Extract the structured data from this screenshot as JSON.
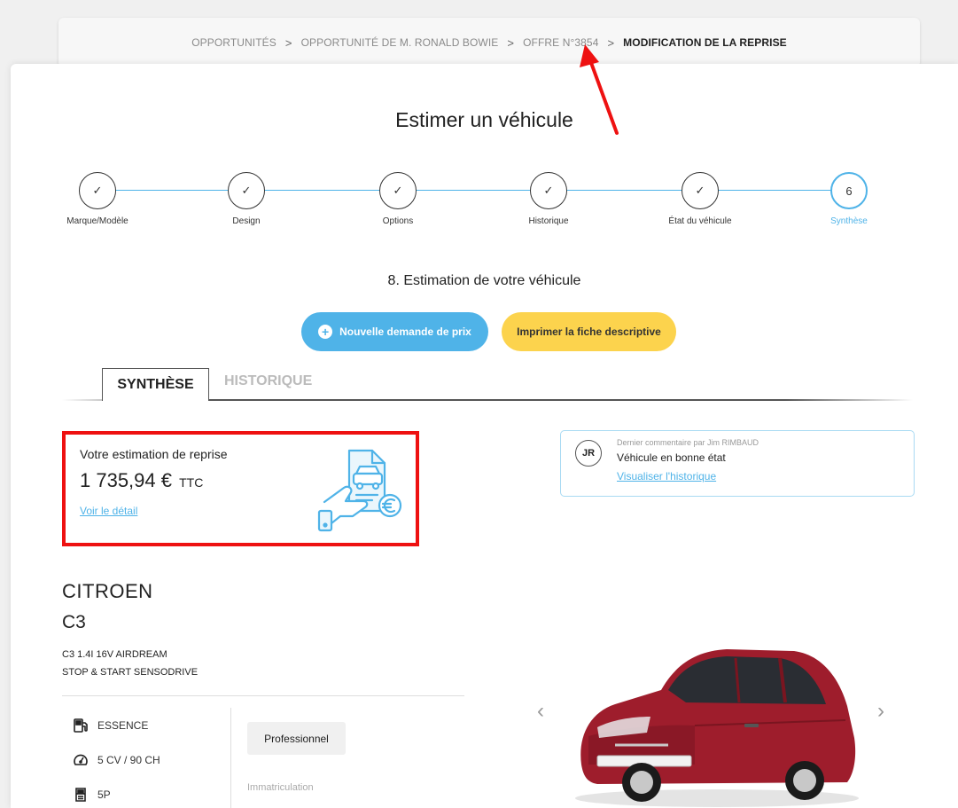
{
  "breadcrumb": {
    "items": [
      "OPPORTUNITÉS",
      "OPPORTUNITÉ DE M. RONALD BOWIE",
      "OFFRE N°3854"
    ],
    "current": "MODIFICATION DE LA REPRISE",
    "separator": ">"
  },
  "page": {
    "title": "Estimer un véhicule",
    "section_title": "8. Estimation de votre véhicule"
  },
  "stepper": {
    "steps": [
      {
        "label": "Marque/Modèle",
        "mark": "✓"
      },
      {
        "label": "Design",
        "mark": "✓"
      },
      {
        "label": "Options",
        "mark": "✓"
      },
      {
        "label": "Historique",
        "mark": "✓"
      },
      {
        "label": "État du véhicule",
        "mark": "✓"
      },
      {
        "label": "Synthèse",
        "mark": "6"
      }
    ]
  },
  "buttons": {
    "new_request": "Nouvelle demande de prix",
    "print_sheet": "Imprimer la fiche descriptive"
  },
  "tabs": {
    "active": "SYNTHÈSE",
    "inactive": "HISTORIQUE"
  },
  "estimate": {
    "label": "Votre estimation de reprise",
    "amount": "1 735,94 €",
    "tax_label": "TTC",
    "detail_link": "Voir le détail"
  },
  "comment": {
    "initials": "JR",
    "meta": "Dernier commentaire par Jim RIMBAUD",
    "text": "Véhicule en bonne état",
    "history_link": "Visualiser l'historique"
  },
  "vehicle": {
    "brand": "CITROEN",
    "model": "C3",
    "version_line1": "C3 1.4I 16V AIRDREAM",
    "version_line2": "STOP & START SENSODRIVE",
    "specs": [
      {
        "icon": "fuel-pump-icon",
        "text": "ESSENCE"
      },
      {
        "icon": "gauge-icon",
        "text": "5 CV / 90 CH"
      },
      {
        "icon": "car-doors-icon",
        "text": "5P"
      }
    ],
    "seller_type": "Professionnel",
    "registration_label": "Immatriculation"
  },
  "colors": {
    "accent_blue": "#4fb3e8",
    "accent_yellow": "#fcd34d",
    "highlight_red": "#ee1111",
    "car_red": "#9e1d2c"
  }
}
